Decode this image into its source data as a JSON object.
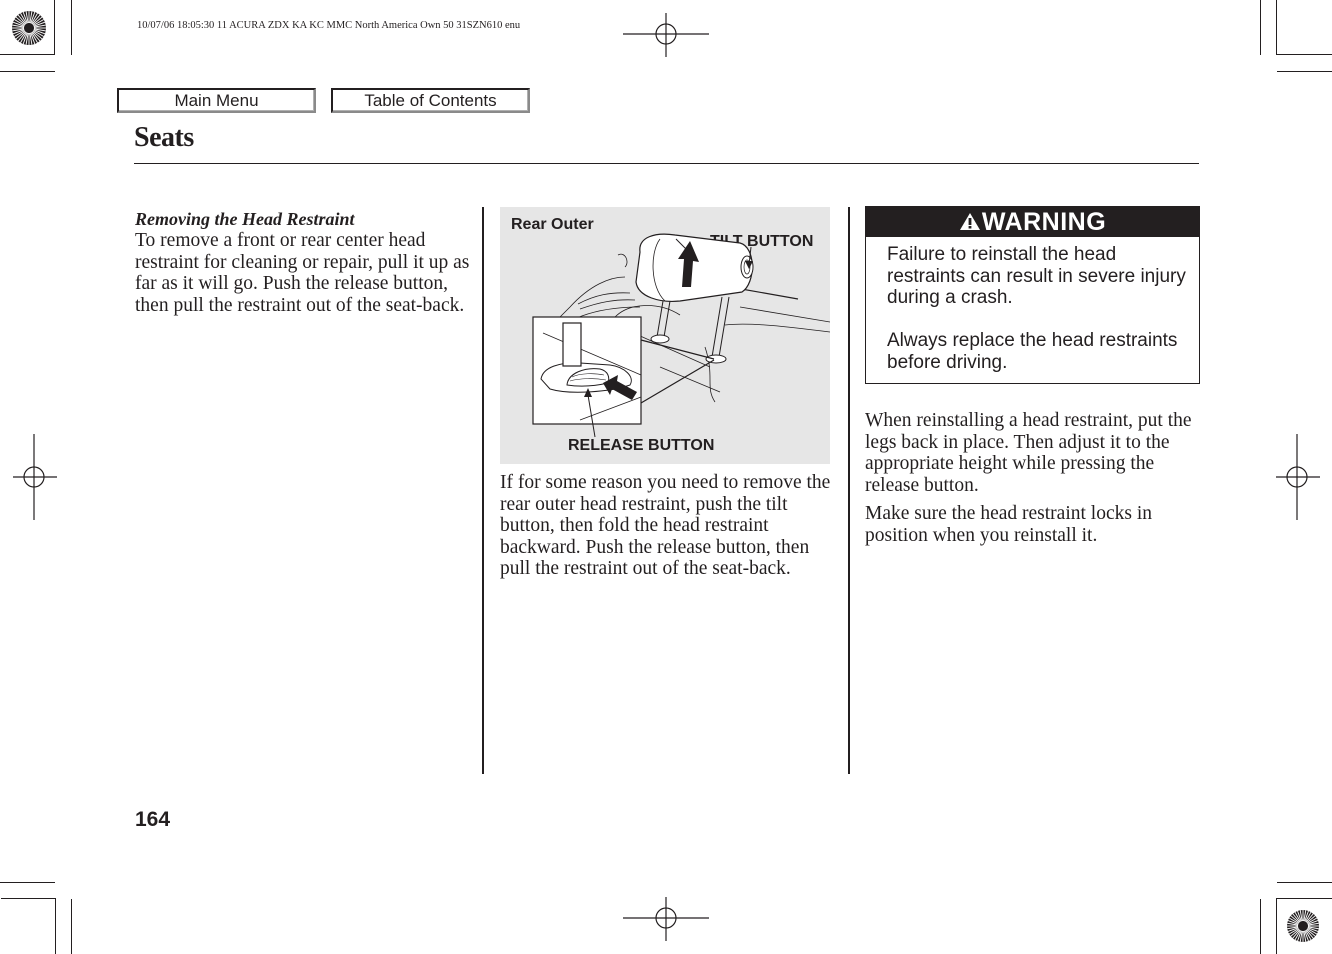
{
  "print_info": "10/07/06 18:05:30    11 ACURA ZDX KA KC MMC North America Own 50 31SZN610 enu",
  "nav": {
    "main_menu_label": "Main Menu",
    "toc_label": "Table of Contents"
  },
  "page": {
    "title": "Seats",
    "number": "164"
  },
  "column1": {
    "subheading": "Removing the Head Restraint",
    "paragraph": "To remove a front or rear center head restraint for cleaning or repair, pull it up as far as it will go. Push the release button, then pull the restraint out of the seat-back."
  },
  "figure": {
    "caption": "Rear Outer",
    "callouts": {
      "tilt_button": "TILT BUTTON",
      "release_button": "RELEASE BUTTON"
    },
    "background_color": "#e6e6e6"
  },
  "column2": {
    "paragraph": "If for some reason you need to remove the rear outer head restraint, push the tilt button, then fold the head restraint backward. Push the release button, then pull the restraint out of the seat-back."
  },
  "warning": {
    "icon": "warning-triangle-icon",
    "heading": "WARNING",
    "paragraphs": [
      "Failure to reinstall the head restraints can result in severe injury during a crash.",
      "Always replace the head restraints before driving."
    ]
  },
  "column3": {
    "paragraphs": [
      "When reinstalling a head restraint, put the legs back in place. Then adjust it to the appropriate height while pressing the release button.",
      "Make sure the head restraint locks in position when you reinstall it."
    ]
  }
}
